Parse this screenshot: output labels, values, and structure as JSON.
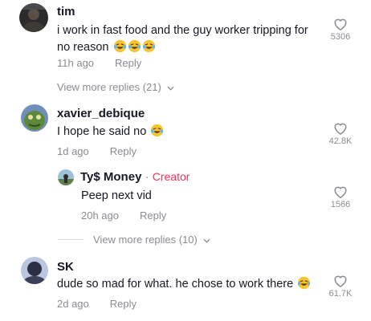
{
  "comments": [
    {
      "username": "tim",
      "text": "i work in fast food and the guy worker tripping for no reason",
      "emoji_count": 3,
      "time": "11h ago",
      "reply_label": "Reply",
      "likes": "5306",
      "view_more": "View more replies (21)"
    },
    {
      "username": "xavier_debique",
      "text": "I hope he said no",
      "emoji_count": 1,
      "time": "1d ago",
      "reply_label": "Reply",
      "likes": "42.8K"
    },
    {
      "username": "SK",
      "text": "dude so mad for what. he chose to work there",
      "emoji_count": 1,
      "time": "2d ago",
      "reply_label": "Reply",
      "likes": "61.7K"
    }
  ],
  "reply": {
    "username": "Ty$ Money",
    "separator": "·",
    "creator_label": "Creator",
    "text": "Peep next vid",
    "time": "20h ago",
    "reply_label": "Reply",
    "likes": "1566",
    "view_more": "View more replies (10)"
  },
  "icons": {
    "like": "heart-outline-icon",
    "emoji": "laughing-crying-emoji",
    "chevron": "chevron-down-icon"
  },
  "colors": {
    "creator": "#fe2c55",
    "muted": "#8a8b91",
    "text": "#161823"
  }
}
